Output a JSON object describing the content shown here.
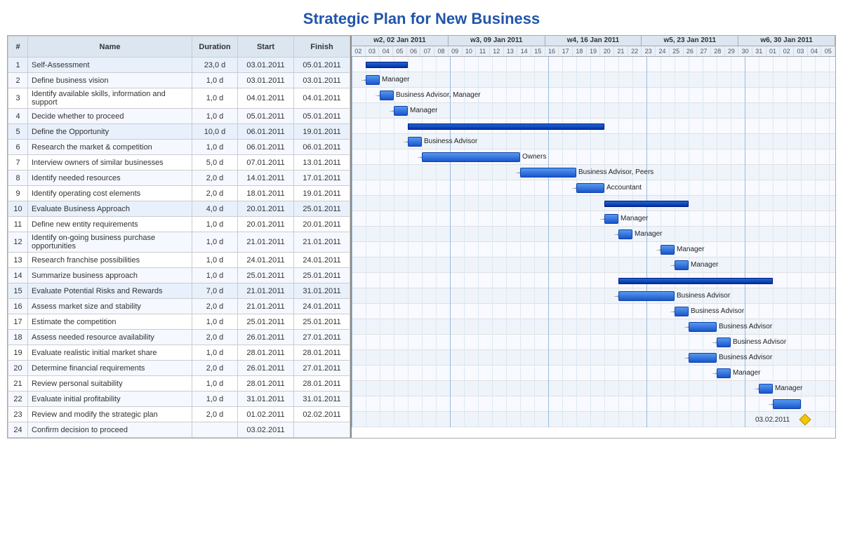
{
  "title": "Strategic Plan for New Business",
  "table": {
    "headers": [
      "#",
      "Name",
      "Duration",
      "Start",
      "Finish"
    ],
    "rows": [
      {
        "id": 1,
        "name": "Self-Assessment",
        "duration": "23,0 d",
        "start": "03.01.2011",
        "finish": "05.01.2011",
        "type": "parent"
      },
      {
        "id": 2,
        "name": "Define business vision",
        "duration": "1,0 d",
        "start": "03.01.2011",
        "finish": "03.01.2011",
        "type": "normal",
        "label": "Manager"
      },
      {
        "id": 3,
        "name": "Identify available skills, information and support",
        "duration": "1,0 d",
        "start": "04.01.2011",
        "finish": "04.01.2011",
        "type": "normal",
        "label": "Business Advisor, Manager"
      },
      {
        "id": 4,
        "name": "Decide whether to proceed",
        "duration": "1,0 d",
        "start": "05.01.2011",
        "finish": "05.01.2011",
        "type": "normal",
        "label": "Manager"
      },
      {
        "id": 5,
        "name": "Define the Opportunity",
        "duration": "10,0 d",
        "start": "06.01.2011",
        "finish": "19.01.2011",
        "type": "parent"
      },
      {
        "id": 6,
        "name": "Research the market & competition",
        "duration": "1,0 d",
        "start": "06.01.2011",
        "finish": "06.01.2011",
        "type": "normal",
        "label": "Business Advisor"
      },
      {
        "id": 7,
        "name": "Interview owners of similar businesses",
        "duration": "5,0 d",
        "start": "07.01.2011",
        "finish": "13.01.2011",
        "type": "normal",
        "label": "Owners"
      },
      {
        "id": 8,
        "name": "Identify needed resources",
        "duration": "2,0 d",
        "start": "14.01.2011",
        "finish": "17.01.2011",
        "type": "normal",
        "label": "Business Advisor, Peers"
      },
      {
        "id": 9,
        "name": "Identify operating cost elements",
        "duration": "2,0 d",
        "start": "18.01.2011",
        "finish": "19.01.2011",
        "type": "normal",
        "label": "Accountant"
      },
      {
        "id": 10,
        "name": "Evaluate Business Approach",
        "duration": "4,0 d",
        "start": "20.01.2011",
        "finish": "25.01.2011",
        "type": "parent"
      },
      {
        "id": 11,
        "name": "Define new entity requirements",
        "duration": "1,0 d",
        "start": "20.01.2011",
        "finish": "20.01.2011",
        "type": "normal",
        "label": "Manager"
      },
      {
        "id": 12,
        "name": "Identify on-going business purchase opportunities",
        "duration": "1,0 d",
        "start": "21.01.2011",
        "finish": "21.01.2011",
        "type": "normal",
        "label": "Manager"
      },
      {
        "id": 13,
        "name": "Research franchise possibilities",
        "duration": "1,0 d",
        "start": "24.01.2011",
        "finish": "24.01.2011",
        "type": "normal",
        "label": "Manager"
      },
      {
        "id": 14,
        "name": "Summarize business approach",
        "duration": "1,0 d",
        "start": "25.01.2011",
        "finish": "25.01.2011",
        "type": "normal",
        "label": "Manager"
      },
      {
        "id": 15,
        "name": "Evaluate Potential Risks and Rewards",
        "duration": "7,0 d",
        "start": "21.01.2011",
        "finish": "31.01.2011",
        "type": "parent"
      },
      {
        "id": 16,
        "name": "Assess market size and stability",
        "duration": "2,0 d",
        "start": "21.01.2011",
        "finish": "24.01.2011",
        "type": "normal",
        "label": "Business Advisor"
      },
      {
        "id": 17,
        "name": "Estimate the competition",
        "duration": "1,0 d",
        "start": "25.01.2011",
        "finish": "25.01.2011",
        "type": "normal",
        "label": "Business Advisor"
      },
      {
        "id": 18,
        "name": "Assess needed resource availability",
        "duration": "2,0 d",
        "start": "26.01.2011",
        "finish": "27.01.2011",
        "type": "normal",
        "label": "Business Advisor"
      },
      {
        "id": 19,
        "name": "Evaluate realistic initial market share",
        "duration": "1,0 d",
        "start": "28.01.2011",
        "finish": "28.01.2011",
        "type": "normal",
        "label": "Business Advisor"
      },
      {
        "id": 20,
        "name": "Determine financial requirements",
        "duration": "2,0 d",
        "start": "26.01.2011",
        "finish": "27.01.2011",
        "type": "normal",
        "label": "Business Advisor"
      },
      {
        "id": 21,
        "name": "Review personal suitability",
        "duration": "1,0 d",
        "start": "28.01.2011",
        "finish": "28.01.2011",
        "type": "normal",
        "label": "Manager"
      },
      {
        "id": 22,
        "name": "Evaluate initial profitability",
        "duration": "1,0 d",
        "start": "31.01.2011",
        "finish": "31.01.2011",
        "type": "normal",
        "label": "Manager"
      },
      {
        "id": 23,
        "name": "Review and modify the strategic plan",
        "duration": "2,0 d",
        "start": "01.02.2011",
        "finish": "02.02.2011",
        "type": "normal"
      },
      {
        "id": 24,
        "name": "Confirm decision to proceed",
        "duration": "",
        "start": "03.02.2011",
        "finish": "",
        "type": "normal"
      }
    ]
  },
  "weeks": [
    {
      "label": "w2, 02 Jan 2011",
      "days": [
        "02",
        "03",
        "04",
        "05",
        "06",
        "07",
        "08"
      ]
    },
    {
      "label": "w3, 09 Jan 2011",
      "days": [
        "09",
        "10",
        "11",
        "12",
        "13",
        "14",
        "15"
      ]
    },
    {
      "label": "w4, 16 Jan 2011",
      "days": [
        "16",
        "17",
        "18",
        "19",
        "20",
        "21",
        "22"
      ]
    },
    {
      "label": "w5, 23 Jan 2011",
      "days": [
        "23",
        "24",
        "25",
        "26",
        "27",
        "28",
        "29"
      ]
    },
    {
      "label": "w6, 30 Jan 2011",
      "days": [
        "30",
        "31",
        "01",
        "02",
        "03",
        "04",
        "05"
      ]
    }
  ]
}
